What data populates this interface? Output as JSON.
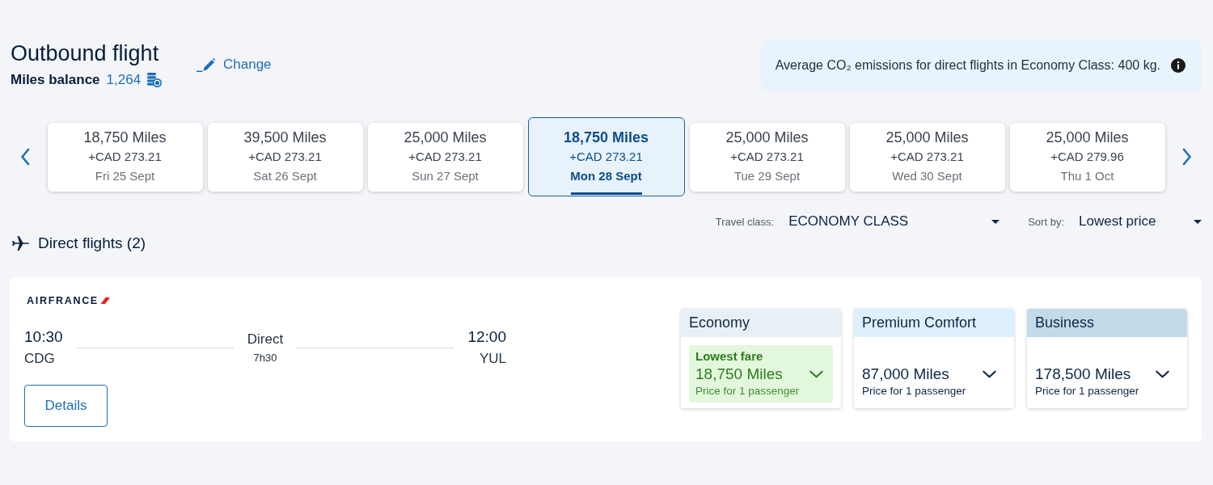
{
  "header": {
    "title": "Outbound flight",
    "change_link": "Change",
    "miles_balance_label": "Miles balance",
    "miles_balance_value": "1,264"
  },
  "emissions_notice": {
    "text": "Average CO₂ emissions for direct flights in Economy Class: 400 kg."
  },
  "date_carousel": {
    "dates": [
      {
        "miles": "18,750 Miles",
        "price": "+CAD 273.21",
        "date": "Fri 25 Sept",
        "selected": false
      },
      {
        "miles": "39,500 Miles",
        "price": "+CAD 273.21",
        "date": "Sat 26 Sept",
        "selected": false
      },
      {
        "miles": "25,000 Miles",
        "price": "+CAD 273.21",
        "date": "Sun 27 Sept",
        "selected": false
      },
      {
        "miles": "18,750 Miles",
        "price": "+CAD 273.21",
        "date": "Mon 28 Sept",
        "selected": true
      },
      {
        "miles": "25,000 Miles",
        "price": "+CAD 273.21",
        "date": "Tue 29 Sept",
        "selected": false
      },
      {
        "miles": "25,000 Miles",
        "price": "+CAD 273.21",
        "date": "Wed 30 Sept",
        "selected": false
      },
      {
        "miles": "25,000 Miles",
        "price": "+CAD 279.96",
        "date": "Thu 1 Oct",
        "selected": false
      }
    ]
  },
  "filters": {
    "travel_class": {
      "label": "Travel class:",
      "value": "ECONOMY CLASS"
    },
    "sort_by": {
      "label": "Sort by:",
      "value": "Lowest price"
    }
  },
  "results": {
    "heading": "Direct flights (2)",
    "flights": [
      {
        "airline": "AIRFRANCE",
        "departure": {
          "time": "10:30",
          "airport": "CDG"
        },
        "stops": "Direct",
        "duration": "7h30",
        "arrival": {
          "time": "12:00",
          "airport": "YUL"
        },
        "details_button": "Details",
        "fares": [
          {
            "cabin": "Economy",
            "color": "#e8f0f7",
            "highlighted": true,
            "badge": "Lowest fare",
            "miles": "18,750 Miles",
            "note": "Price for 1 passenger"
          },
          {
            "cabin": "Premium Comfort",
            "color": "#def0fc",
            "highlighted": false,
            "miles": "87,000 Miles",
            "note": "Price for 1 passenger"
          },
          {
            "cabin": "Business",
            "color": "#c3dbe9",
            "highlighted": false,
            "miles": "178,500 Miles",
            "note": "Price for 1 passenger"
          }
        ]
      }
    ]
  }
}
